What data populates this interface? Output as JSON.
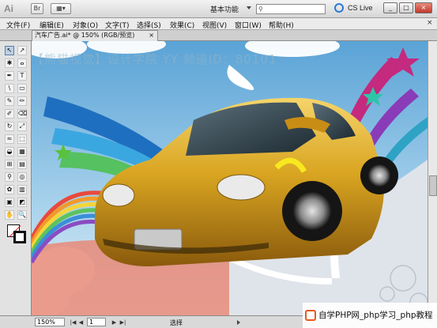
{
  "titlebar": {
    "app_icon": "Ai",
    "bridge_btn": "Br",
    "workspace_label": "基本功能",
    "cs_live": "CS Live",
    "window_buttons": [
      "_",
      "□",
      "×"
    ]
  },
  "menu": {
    "items": [
      "文件(F)",
      "编辑(E)",
      "对象(O)",
      "文字(T)",
      "选择(S)",
      "效果(C)",
      "视图(V)",
      "窗口(W)",
      "帮助(H)"
    ],
    "close": "×"
  },
  "document": {
    "tab_title": "汽车广告.ai* @ 150% (RGB/预览)",
    "tab_close": "×",
    "watermark": "【熊猫视觉】设计学院  YY 频道ID：80101"
  },
  "tools": {
    "icons": [
      "selection-arrow",
      "direct-selection",
      "magic-wand",
      "lasso",
      "pen",
      "type",
      "line-segment",
      "rectangle",
      "paintbrush",
      "pencil",
      "blob-brush",
      "eraser",
      "rotate",
      "scale",
      "width",
      "free-transform",
      "shape-builder",
      "perspective-grid",
      "mesh",
      "gradient",
      "eyedropper",
      "blend",
      "symbol-sprayer",
      "column-graph",
      "artboard",
      "slice",
      "hand",
      "zoom"
    ],
    "glyphs": [
      "↖",
      "↗",
      "✱",
      "ⴰ",
      "✒",
      "T",
      "\\",
      "▭",
      "✎",
      "✏",
      "✐",
      "⌫",
      "↻",
      "⤢",
      "≈",
      "⬚",
      "◒",
      "▦",
      "⊞",
      "▤",
      "⚲",
      "◎",
      "✿",
      "▥",
      "▣",
      "◩",
      "✋",
      "🔍"
    ]
  },
  "status": {
    "zoom": "150%",
    "page": "1",
    "tool_label": "选择",
    "nav_glyphs": [
      "|◀",
      "◀",
      "▶",
      "▶|"
    ]
  },
  "overlay": {
    "site_text": "自学PHP网_php学习_php教程"
  },
  "colors": {
    "car_body": "#d9a521",
    "sky": "#7fb9df",
    "rainbow_stripes": [
      "#e84a3c",
      "#f19a2b",
      "#f3d53b",
      "#5cc25f",
      "#3a8fd8",
      "#8a4cc2"
    ],
    "accent_pink": "#c42a7e",
    "floor": "#e88a78"
  }
}
